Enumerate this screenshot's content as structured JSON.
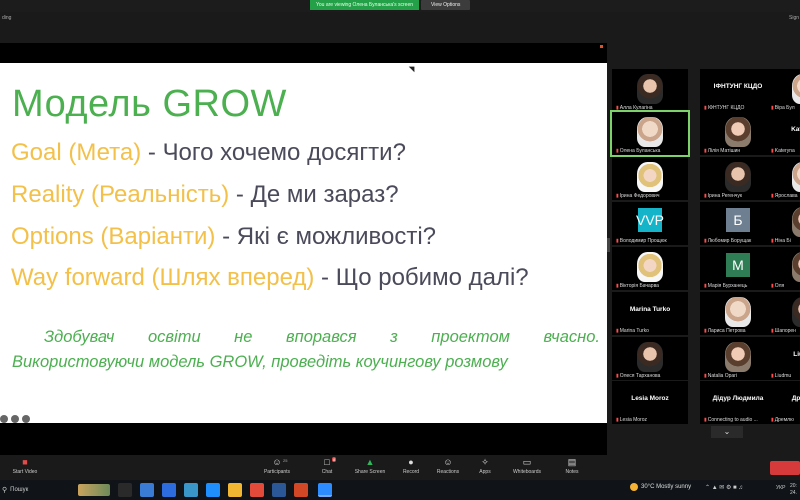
{
  "screen_share": {
    "banner_text": "You are viewing Олена Буланська's screen",
    "view_options": "View Options",
    "left_partial": "ding",
    "right_partial": "Sign"
  },
  "slide": {
    "title": "Модель GROW",
    "lines": [
      {
        "key_initial": "G",
        "key_rest": "oal (Мета)",
        "question": " - Чого хочемо досягти?"
      },
      {
        "key_initial": "R",
        "key_rest": "eality (Реальність)",
        "question": " - Де ми зараз?"
      },
      {
        "key_initial": "O",
        "key_rest": "ptions (Варіанти)",
        "question": " - Які є можливості?"
      },
      {
        "key_initial": "W",
        "key_rest": "ay forward (Шлях вперед)",
        "question": " - Що робимо далі?"
      }
    ],
    "task_line_1": "Здобувач освіти не впорався з проектом вчасно.",
    "task_line_2": "Використовуючи модель GROW, проведіть коучингову розмову"
  },
  "participants": [
    {
      "name": "Алла Кулагіна",
      "kind": "face",
      "tone": "dark",
      "active": false
    },
    {
      "name": "ІФНТУНГ КЦДО",
      "big": "ІФНТУНГ КЦДО",
      "kind": "text",
      "active": false
    },
    {
      "name": "Віра Бул",
      "kind": "face",
      "tone": "light",
      "active": false
    },
    {
      "name": "Олена Буланська",
      "kind": "face",
      "tone": "light",
      "active": true
    },
    {
      "name": "Лілія Матішин",
      "kind": "face",
      "tone": "wall",
      "active": false
    },
    {
      "name": "Kateryna",
      "big": "Kateryna",
      "kind": "text",
      "active": false
    },
    {
      "name": "Ірина Федорович",
      "kind": "face",
      "tone": "blonde",
      "active": false
    },
    {
      "name": "Ірина Регенчук",
      "kind": "face",
      "tone": "dark",
      "active": false
    },
    {
      "name": "Ярослава",
      "kind": "face",
      "tone": "light",
      "active": false
    },
    {
      "name": "Володимир Прощюк",
      "kind": "badge",
      "badge_text": "VVP",
      "badge_color": "#16b4c9",
      "active": false
    },
    {
      "name": "Любомир Борущак",
      "kind": "badge",
      "badge_text": "Б",
      "badge_color": "#6e7f92",
      "active": false
    },
    {
      "name": "Ніна Бі",
      "kind": "face",
      "tone": "wall",
      "active": false
    },
    {
      "name": "Вікторія Бачарва",
      "kind": "face",
      "tone": "blonde",
      "active": false
    },
    {
      "name": "Марія Бурханець",
      "kind": "badge",
      "badge_text": "M",
      "badge_color": "#2e7d55",
      "active": false
    },
    {
      "name": "Оля",
      "kind": "face",
      "tone": "wall",
      "active": false
    },
    {
      "name": "Marina Turko",
      "big": "Marina Turko",
      "kind": "text",
      "active": false
    },
    {
      "name": "Лариса Петрова",
      "kind": "face",
      "tone": "light",
      "active": false
    },
    {
      "name": "Шапорен",
      "kind": "face",
      "tone": "dark",
      "active": false
    },
    {
      "name": "Олеся Тарханова",
      "kind": "face",
      "tone": "dark",
      "active": false
    },
    {
      "name": "Natalia Opari",
      "kind": "face",
      "tone": "wall",
      "active": false
    },
    {
      "name": "Liudmu",
      "big": "Liudmu",
      "kind": "text",
      "active": false
    },
    {
      "name": "Lesia Moroz",
      "big": "Lesia Moroz",
      "kind": "text",
      "active": false
    },
    {
      "name": "Connecting to audio ...",
      "big": "Дідур Людмила",
      "kind": "text",
      "active": false
    },
    {
      "name": "Дремлю",
      "big": "Дремлю",
      "kind": "text",
      "active": false
    }
  ],
  "toolbar": {
    "start_video": "Start Video",
    "participants": "Participants",
    "participants_count": "25",
    "chat": "Chat",
    "chat_badge": "8",
    "share_screen": "Share Screen",
    "record": "Record",
    "reactions": "Reactions",
    "apps": "Apps",
    "whiteboards": "Whiteboards",
    "notes": "Notes"
  },
  "taskbar": {
    "search": "Пошук",
    "weather": "30°C  Mostly sunny",
    "lang": "УКР",
    "time": "20:",
    "date": "24."
  }
}
